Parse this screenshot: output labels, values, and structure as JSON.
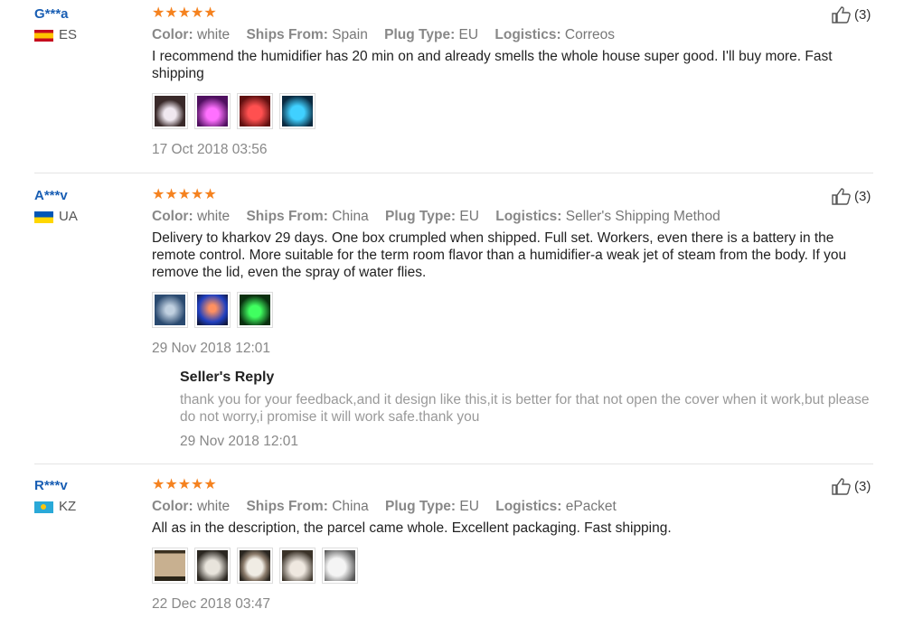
{
  "labels": {
    "color": "Color:",
    "ships_from": "Ships From:",
    "plug_type": "Plug Type:",
    "logistics": "Logistics:",
    "seller_reply": "Seller's Reply"
  },
  "rating_stars": "★★★★★",
  "reviews": [
    {
      "user": "G***a",
      "country": "ES",
      "rating": 5,
      "likes": "(3)",
      "color": "white",
      "ships_from": "Spain",
      "plug_type": "EU",
      "logistics": "Correos",
      "text": "I recommend the humidifier has 20 min on and already smells the whole house super good. I'll buy more. Fast shipping",
      "photo_colors": [
        "#3a2a2a",
        "#b020c0",
        "#c02020",
        "#1ab0e0"
      ],
      "date": "17 Oct 2018 03:56"
    },
    {
      "user": "A***v",
      "country": "UA",
      "rating": 5,
      "likes": "(3)",
      "color": "white",
      "ships_from": "China",
      "plug_type": "EU",
      "logistics": "Seller's Shipping Method",
      "text": "Delivery to kharkov 29 days. One box crumpled when shipped. Full set. Workers, even there is a battery in the remote control. More suitable for the term room flavor than a humidifier-a weak jet of steam from the body. If you remove the lid, even the spray of water flies.",
      "photo_colors": [
        "#4a6a90",
        "#3050c0",
        "#18a030"
      ],
      "date": "29 Nov 2018 12:01",
      "seller_reply": {
        "text": "thank you for your feedback,and it design like this,it is better for that not open the cover when it work,but please do not worry,i promise it will work safe.thank you",
        "date": "29 Nov 2018 12:01"
      }
    },
    {
      "user": "R***v",
      "country": "KZ",
      "rating": 5,
      "likes": "(3)",
      "color": "white",
      "ships_from": "China",
      "plug_type": "EU",
      "logistics": "ePacket",
      "text": "All as in the description, the parcel came whole. Excellent packaging. Fast shipping.",
      "photo_colors": [
        "#c8b090",
        "#b0a898",
        "#d8d0c4",
        "#c8c0b4",
        "#e0e0e0"
      ],
      "date": "22 Dec 2018 03:47"
    }
  ]
}
